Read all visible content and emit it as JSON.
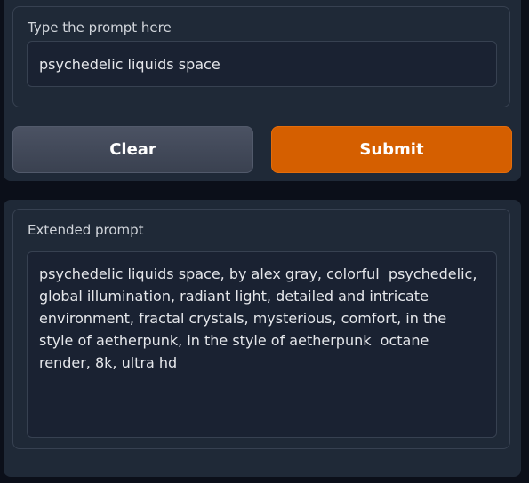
{
  "prompt": {
    "label": "Type the prompt here",
    "value": "psychedelic liquids space"
  },
  "actions": {
    "clear_label": "Clear",
    "submit_label": "Submit"
  },
  "extended": {
    "label": "Extended prompt",
    "value": "psychedelic liquids space, by alex gray, colorful  psychedelic, global illumination, radiant light, detailed and intricate environment, fractal crystals, mysterious, comfort, in the style of aetherpunk, in the style of aetherpunk  octane render, 8k, ultra hd"
  },
  "colors": {
    "background": "#0b0f19",
    "panel": "#1f2937",
    "submit": "#d55f00",
    "clear": "#4b5263"
  }
}
